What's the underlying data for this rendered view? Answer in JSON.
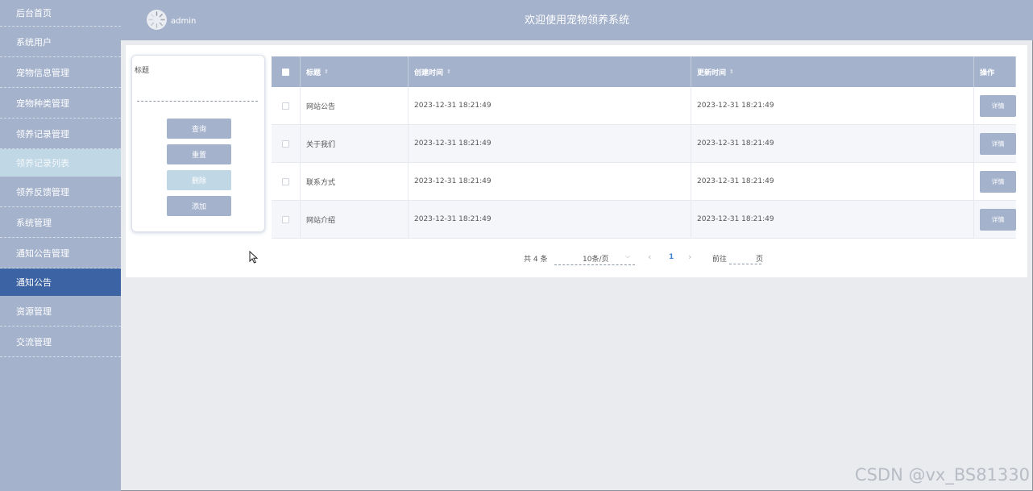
{
  "sidebar": {
    "items": [
      {
        "label": "后台首页"
      },
      {
        "label": "系统用户"
      },
      {
        "label": "宠物信息管理"
      },
      {
        "label": "宠物种类管理"
      },
      {
        "label": "领养记录管理"
      },
      {
        "label": "领养记录列表"
      },
      {
        "label": "领养反馈管理"
      },
      {
        "label": "系统管理"
      },
      {
        "label": "通知公告管理"
      },
      {
        "label": "通知公告"
      },
      {
        "label": "资源管理"
      },
      {
        "label": "交流管理"
      }
    ]
  },
  "header": {
    "username": "admin",
    "title": "欢迎使用宠物领养系统"
  },
  "search": {
    "label": "标题",
    "value": "",
    "buttons": {
      "query": "查询",
      "reset": "重置",
      "delete": "删除",
      "add": "添加"
    }
  },
  "table": {
    "columns": {
      "title": "标题",
      "created": "创建时间",
      "updated": "更新时间",
      "operation": "操作"
    },
    "rows": [
      {
        "title": "网站公告",
        "created": "2023-12-31 18:21:49",
        "updated": "2023-12-31 18:21:49",
        "action": "详情"
      },
      {
        "title": "关于我们",
        "created": "2023-12-31 18:21:49",
        "updated": "2023-12-31 18:21:49",
        "action": "详情"
      },
      {
        "title": "联系方式",
        "created": "2023-12-31 18:21:49",
        "updated": "2023-12-31 18:21:49",
        "action": "详情"
      },
      {
        "title": "网站介绍",
        "created": "2023-12-31 18:21:49",
        "updated": "2023-12-31 18:21:49",
        "action": "详情"
      }
    ]
  },
  "pagination": {
    "total": "共 4 条",
    "page_size": "10条/页",
    "current_page": "1",
    "goto_label": "前往",
    "goto_value": "",
    "page_unit": "页"
  },
  "watermark": "CSDN @vx_BS81330",
  "colors": {
    "sidebar_bg": "#a4b2cc",
    "active_item_bg": "#c0d7e5",
    "highlight_item_bg": "#3c63a3",
    "accent_blue": "#3f87d4"
  }
}
